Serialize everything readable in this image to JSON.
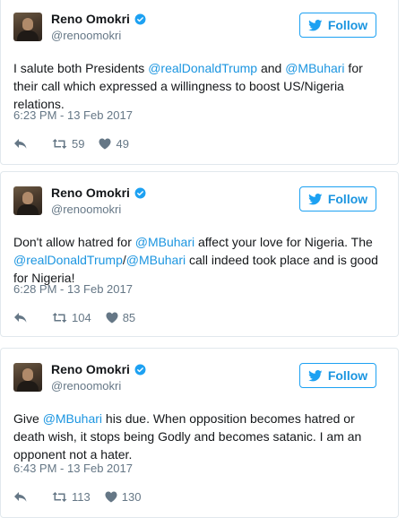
{
  "colors": {
    "link": "#1b95e0",
    "muted": "#657786",
    "border": "#e1e8ed"
  },
  "tweets": [
    {
      "author": "Reno Omokri",
      "handle": "@renoomokri",
      "follow_label": "Follow",
      "text": [
        {
          "t": "text",
          "v": "I salute both Presidents "
        },
        {
          "t": "link",
          "v": "@realDonaldTrump"
        },
        {
          "t": "text",
          "v": " and "
        },
        {
          "t": "link",
          "v": "@MBuhari"
        },
        {
          "t": "text",
          "v": " for their call which expressed a willingness to boost US/Nigeria relations."
        }
      ],
      "timestamp": "6:23 PM - 13 Feb 2017",
      "retweets": "59",
      "likes": "49"
    },
    {
      "author": "Reno Omokri",
      "handle": "@renoomokri",
      "follow_label": "Follow",
      "text": [
        {
          "t": "text",
          "v": "Don't allow hatred for "
        },
        {
          "t": "link",
          "v": "@MBuhari"
        },
        {
          "t": "text",
          "v": " affect your love for Nigeria. The "
        },
        {
          "t": "link",
          "v": "@realDonaldTrump"
        },
        {
          "t": "text",
          "v": "/"
        },
        {
          "t": "link",
          "v": "@MBuhari"
        },
        {
          "t": "text",
          "v": " call indeed took place and is good for Nigeria!"
        }
      ],
      "timestamp": "6:28 PM - 13 Feb 2017",
      "retweets": "104",
      "likes": "85"
    },
    {
      "author": "Reno Omokri",
      "handle": "@renoomokri",
      "follow_label": "Follow",
      "text": [
        {
          "t": "text",
          "v": "Give "
        },
        {
          "t": "link",
          "v": "@MBuhari"
        },
        {
          "t": "text",
          "v": " his due. When opposition becomes hatred or death wish, it stops being Godly and becomes satanic. I am an opponent not a hater."
        }
      ],
      "timestamp": "6:43 PM - 13 Feb 2017",
      "retweets": "113",
      "likes": "130"
    }
  ]
}
